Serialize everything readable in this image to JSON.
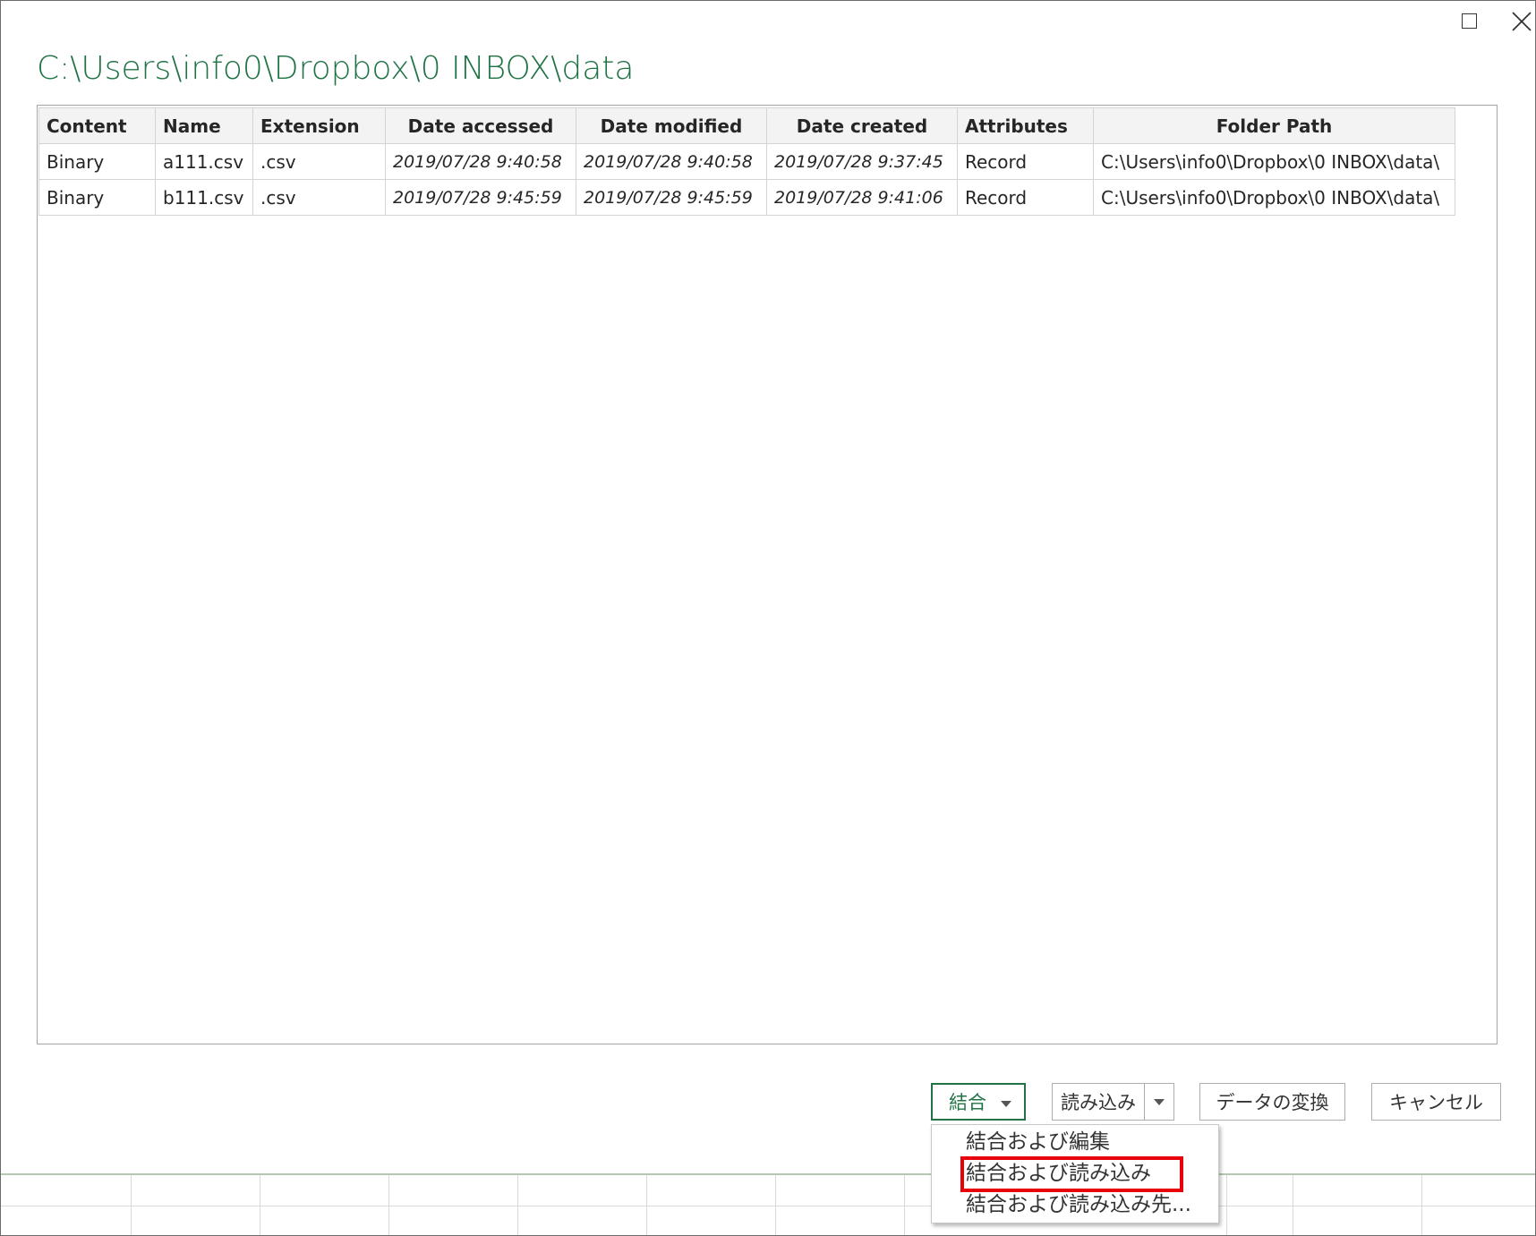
{
  "window": {
    "title": "C:\\Users\\info0\\Dropbox\\0 INBOX\\data",
    "maximize_icon": "maximize-icon",
    "close_icon": "close-icon"
  },
  "table": {
    "columns": [
      "Content",
      "Name",
      "Extension",
      "Date accessed",
      "Date modified",
      "Date created",
      "Attributes",
      "Folder Path"
    ],
    "rows": [
      [
        "Binary",
        "a111.csv",
        ".csv",
        "2019/07/28 9:40:58",
        "2019/07/28 9:40:58",
        "2019/07/28 9:37:45",
        "Record",
        "C:\\Users\\info0\\Dropbox\\0 INBOX\\data\\"
      ],
      [
        "Binary",
        "b111.csv",
        ".csv",
        "2019/07/28 9:45:59",
        "2019/07/28 9:45:59",
        "2019/07/28 9:41:06",
        "Record",
        "C:\\Users\\info0\\Dropbox\\0 INBOX\\data\\"
      ]
    ]
  },
  "buttons": {
    "combine": "結合",
    "load": "読み込み",
    "transform": "データの変換",
    "cancel": "キャンセル"
  },
  "combine_menu": {
    "items": [
      "結合および編集",
      "結合および読み込み",
      "結合および読み込み先..."
    ],
    "highlighted_index": 1
  },
  "colors": {
    "accent": "#217346",
    "highlight": "#e8000b"
  }
}
